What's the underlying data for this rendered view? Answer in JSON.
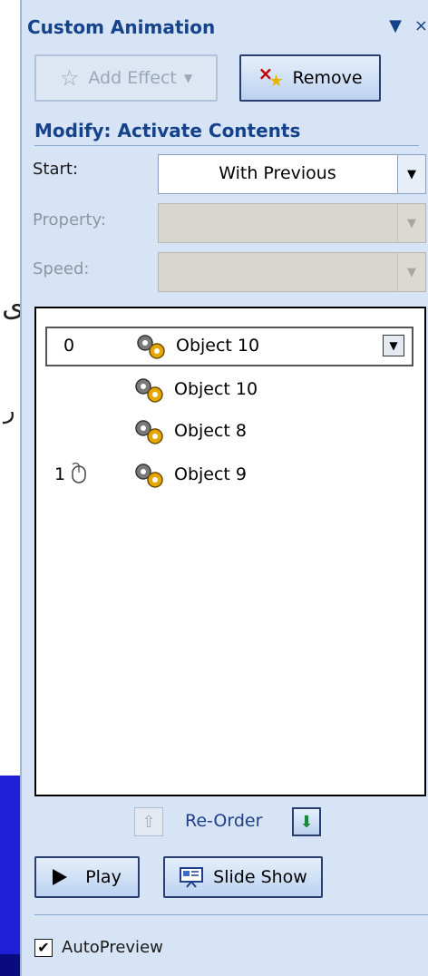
{
  "pane": {
    "title": "Custom Animation",
    "menu_glyph": "▼",
    "close_glyph": "×"
  },
  "toolbar": {
    "add_effect_label": "Add Effect",
    "remove_label": "Remove"
  },
  "modify": {
    "title": "Modify: Activate Contents",
    "start_label": "Start:",
    "start_value": "With Previous",
    "property_label": "Property:",
    "property_value": "",
    "speed_label": "Speed:",
    "speed_value": ""
  },
  "animation_list": {
    "items": [
      {
        "order": "0",
        "trigger": "",
        "name": "Object 10",
        "selected": true
      },
      {
        "order": "",
        "trigger": "",
        "name": "Object 10",
        "selected": false
      },
      {
        "order": "",
        "trigger": "",
        "name": "Object 8",
        "selected": false
      },
      {
        "order": "1",
        "trigger": "on-click",
        "name": "Object 9",
        "selected": false
      }
    ]
  },
  "reorder": {
    "label": "Re-Order"
  },
  "playback": {
    "play_label": "Play",
    "slideshow_label": "Slide Show"
  },
  "autopreview": {
    "label": "AutoPreview",
    "checked": true
  },
  "colors": {
    "pane_bg": "#d6e4f5",
    "heading": "#15428b",
    "button_border": "#2a3f6e"
  }
}
